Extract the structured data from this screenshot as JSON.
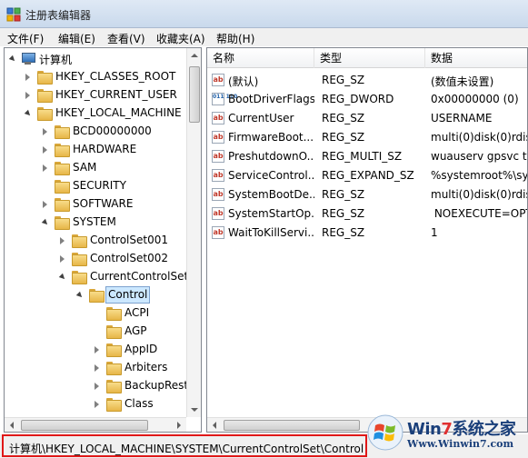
{
  "window": {
    "title": "注册表编辑器"
  },
  "menu": [
    "文件(F)",
    "编辑(E)",
    "查看(V)",
    "收藏夹(A)",
    "帮助(H)"
  ],
  "tree": [
    {
      "label": "计算机",
      "icon": "computer-icon",
      "state": "expanded"
    },
    {
      "label": "HKEY_CLASSES_ROOT",
      "state": "collapsed"
    },
    {
      "label": "HKEY_CURRENT_USER",
      "state": "collapsed"
    },
    {
      "label": "HKEY_LOCAL_MACHINE",
      "state": "expanded"
    },
    {
      "label": "BCD00000000",
      "state": "collapsed"
    },
    {
      "label": "HARDWARE",
      "state": "collapsed"
    },
    {
      "label": "SAM",
      "state": "collapsed"
    },
    {
      "label": "SECURITY",
      "state": "none"
    },
    {
      "label": "SOFTWARE",
      "state": "collapsed"
    },
    {
      "label": "SYSTEM",
      "state": "expanded"
    },
    {
      "label": "ControlSet001",
      "state": "collapsed"
    },
    {
      "label": "ControlSet002",
      "state": "collapsed"
    },
    {
      "label": "CurrentControlSet",
      "state": "expanded"
    },
    {
      "label": "Control",
      "state": "expanded",
      "selected": true
    },
    {
      "label": "ACPI",
      "state": "none"
    },
    {
      "label": "AGP",
      "state": "none"
    },
    {
      "label": "AppID",
      "state": "collapsed"
    },
    {
      "label": "Arbiters",
      "state": "collapsed"
    },
    {
      "label": "BackupRest",
      "state": "collapsed"
    },
    {
      "label": "Class",
      "state": "collapsed"
    }
  ],
  "columns": [
    "名称",
    "类型",
    "数据"
  ],
  "values": [
    {
      "name": "(默认)",
      "type": "REG_SZ",
      "data": "(数值未设置)",
      "icon": "string-value-icon"
    },
    {
      "name": "BootDriverFlags",
      "type": "REG_DWORD",
      "data": "0x00000000 (0)",
      "icon": "binary-value-icon"
    },
    {
      "name": "CurrentUser",
      "type": "REG_SZ",
      "data": "USERNAME",
      "icon": "string-value-icon"
    },
    {
      "name": "FirmwareBoot...",
      "type": "REG_SZ",
      "data": "multi(0)disk(0)rdisk",
      "icon": "string-value-icon"
    },
    {
      "name": "PreshutdownO...",
      "type": "REG_MULTI_SZ",
      "data": "wuauserv gpsvc tru",
      "icon": "string-value-icon"
    },
    {
      "name": "ServiceControl...",
      "type": "REG_EXPAND_SZ",
      "data": "%systemroot%\\sys",
      "icon": "string-value-icon"
    },
    {
      "name": "SystemBootDe...",
      "type": "REG_SZ",
      "data": "multi(0)disk(0)rdisk",
      "icon": "string-value-icon"
    },
    {
      "name": "SystemStartOp...",
      "type": "REG_SZ",
      "data": " NOEXECUTE=OPT",
      "icon": "string-value-icon"
    },
    {
      "name": "WaitToKillServi...",
      "type": "REG_SZ",
      "data": "1",
      "icon": "string-value-icon"
    }
  ],
  "status": {
    "path": "计算机\\HKEY_LOCAL_MACHINE\\SYSTEM\\CurrentControlSet\\Control"
  },
  "watermark": {
    "brand_a": "Win",
    "brand_seven": "7",
    "brand_b": "系统之家",
    "site": "Www.Winwin7.com"
  },
  "icons": {
    "string": "ab",
    "binary": "011 110"
  },
  "colors": {
    "highlight": "#cce8ff",
    "status_outline": "#e01818"
  }
}
